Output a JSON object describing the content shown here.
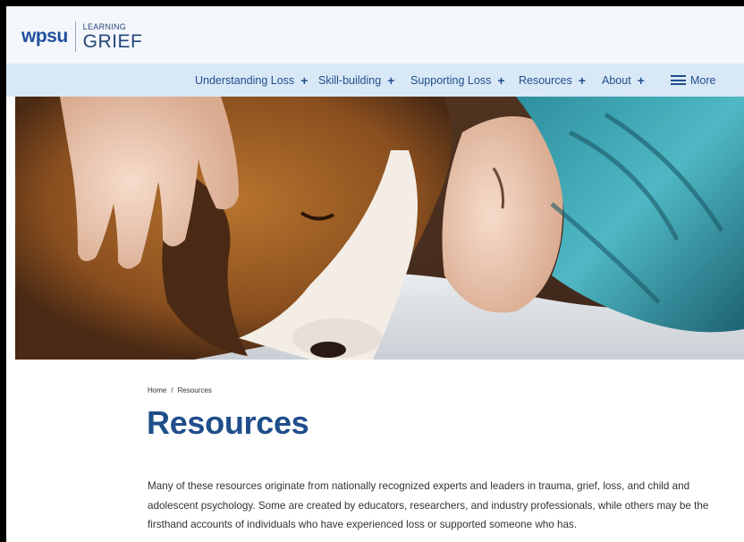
{
  "header": {
    "logo_brand": "wpsu",
    "logo_line1": "LEARNING",
    "logo_line2": "GRIEF"
  },
  "nav": {
    "items": [
      {
        "label": "Understanding Loss"
      },
      {
        "label": "Skill-building"
      },
      {
        "label": "Supporting Loss"
      },
      {
        "label": "Resources"
      },
      {
        "label": "About"
      }
    ],
    "more_label": "More"
  },
  "breadcrumb": {
    "home": "Home",
    "separator": "/",
    "current": "Resources"
  },
  "page": {
    "title": "Resources",
    "intro": "Many of these resources originate from nationally recognized experts and leaders in trauma, grief, loss, and child and adolescent psychology. Some are created by educators, researchers, and industry professionals, while others may be the firsthand accounts of individuals who have experienced loss or supported someone who has."
  },
  "colors": {
    "brand": "#1f4e9c",
    "nav_bg": "#d9e8f7",
    "header_bg": "#f4f7fb"
  }
}
